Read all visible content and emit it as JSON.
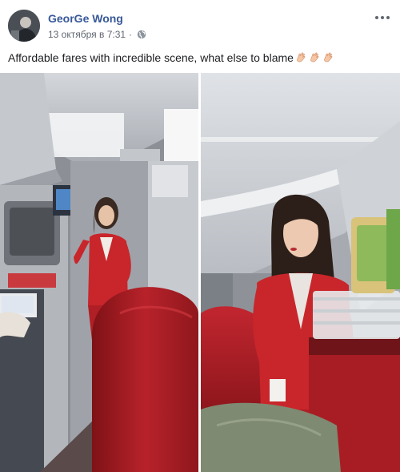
{
  "post": {
    "author_name": "GeorGe Wong",
    "timestamp": "13 октября в 7:31",
    "privacy_icon": "globe-icon",
    "menu_icon": "more-options-icon",
    "caption": "Affordable fares with incredible scene, what else to blame",
    "caption_emoji": [
      "clapping-hands-icon",
      "clapping-hands-icon",
      "clapping-hands-icon"
    ],
    "photos": [
      {
        "name": "cabin-photo-left",
        "subject": "flight attendant standing in aircraft aisle"
      },
      {
        "name": "cabin-photo-right",
        "subject": "flight attendant beside service cart"
      }
    ]
  },
  "colors": {
    "author_link": "#385898",
    "secondary_text": "#616770",
    "uniform_red": "#c8262b",
    "seat_red": "#b8222a"
  }
}
